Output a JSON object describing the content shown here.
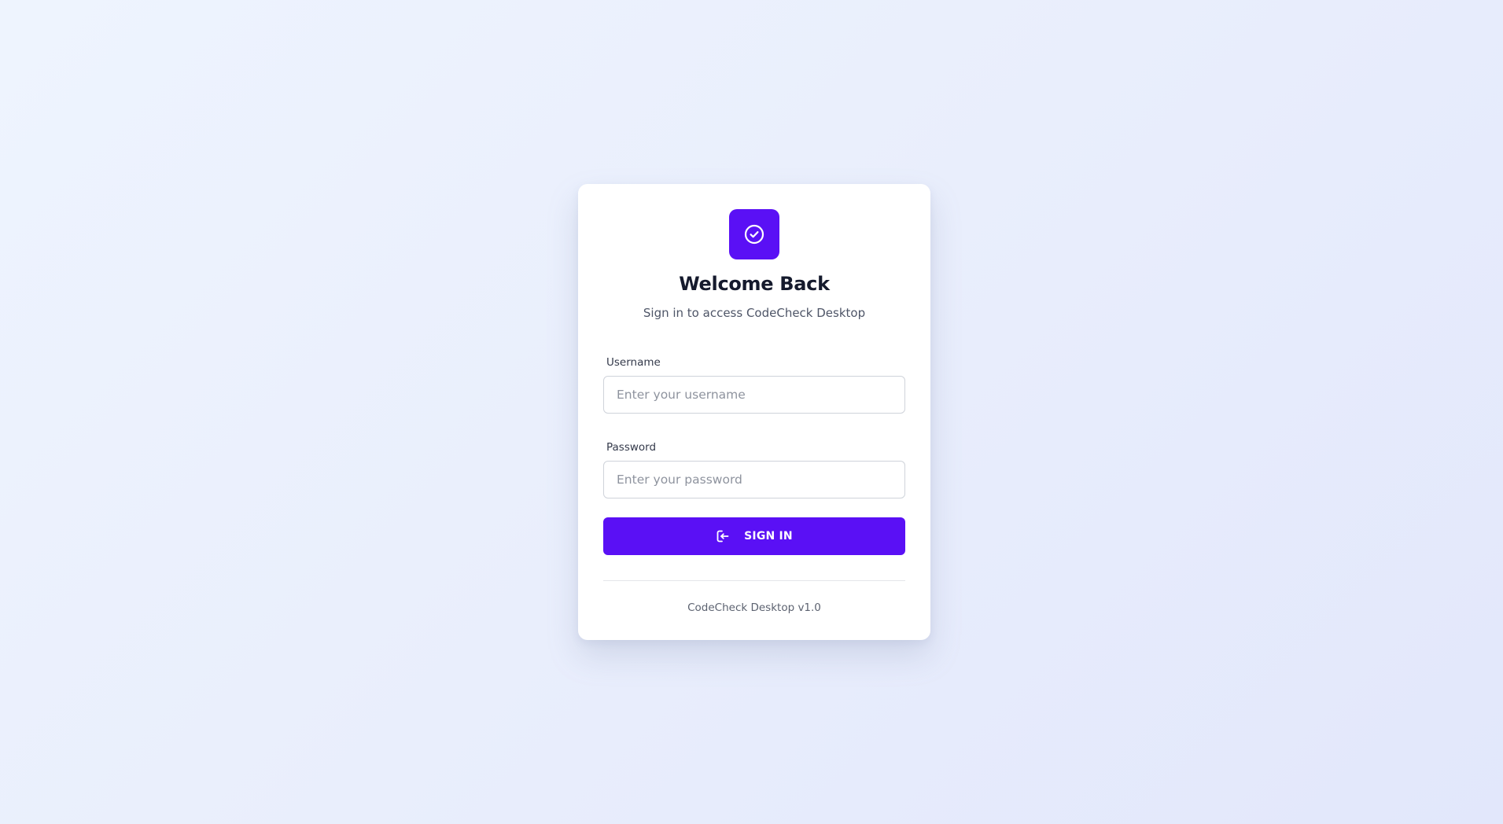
{
  "app": {
    "logo_icon": "check-circle-icon",
    "accent_color": "#5a10f5"
  },
  "header": {
    "title": "Welcome Back",
    "subtitle": "Sign in to access CodeCheck Desktop"
  },
  "form": {
    "username": {
      "label": "Username",
      "value": "",
      "placeholder": "Enter your username"
    },
    "password": {
      "label": "Password",
      "value": "",
      "placeholder": "Enter your password"
    },
    "submit": {
      "label": "SIGN IN",
      "icon": "login-icon"
    }
  },
  "footer": {
    "version_text": "CodeCheck Desktop v1.0"
  }
}
